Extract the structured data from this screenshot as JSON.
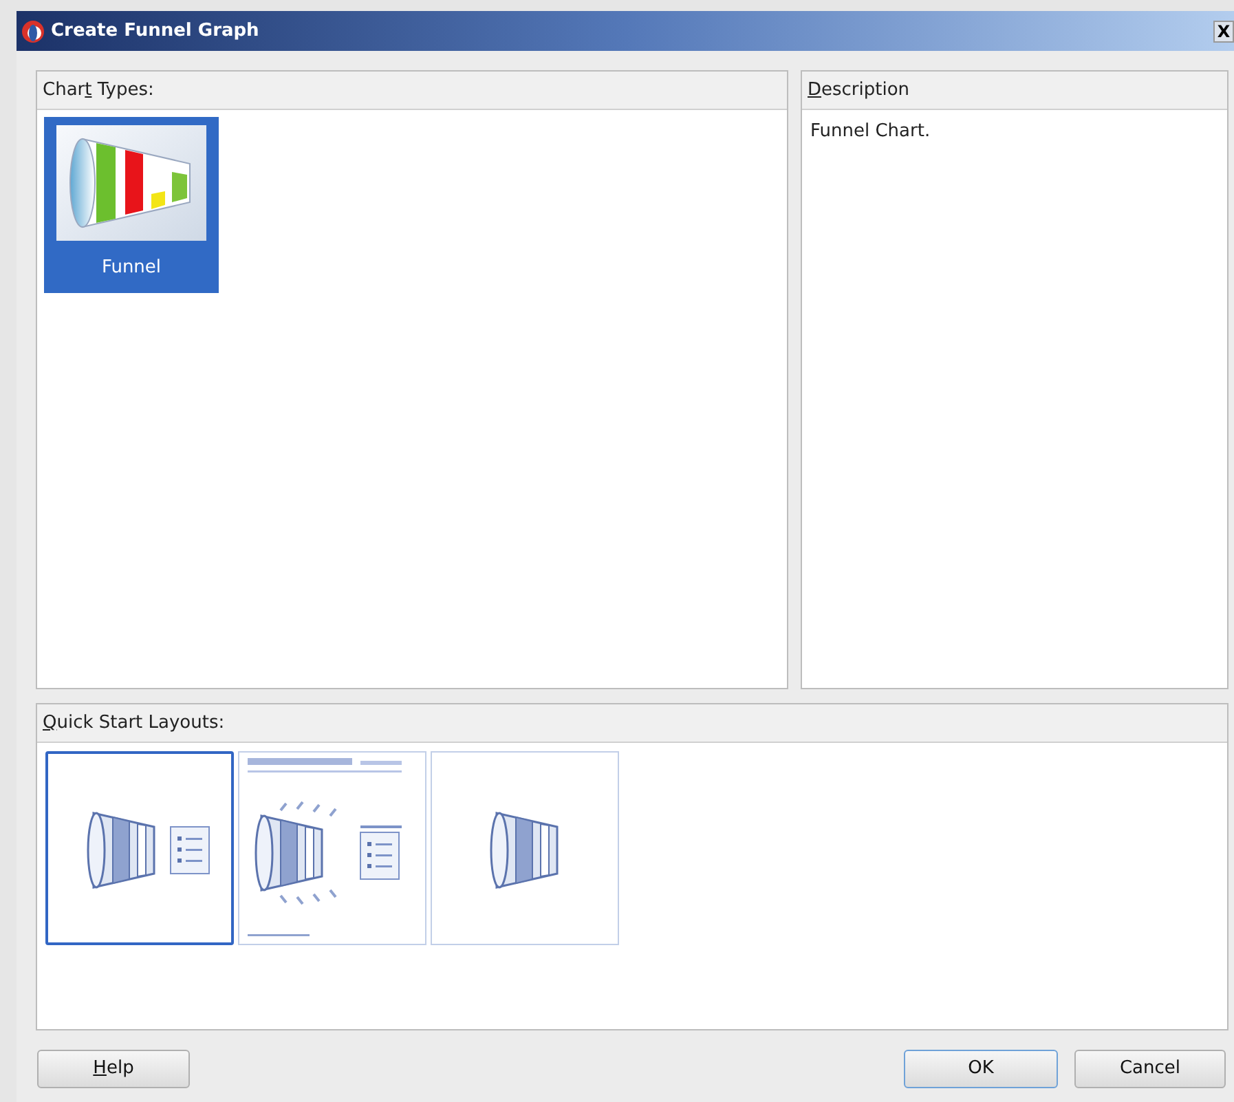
{
  "window": {
    "title": "Create Funnel Graph",
    "close_label": "X"
  },
  "chart_types": {
    "label": {
      "before": "Char",
      "mnemonic": "t",
      "after": " Types:"
    },
    "items": [
      {
        "label": "Funnel",
        "selected": true
      }
    ]
  },
  "description": {
    "label": {
      "mnemonic": "D",
      "after": "escription"
    },
    "text": "Funnel Chart."
  },
  "quick_start": {
    "label": {
      "mnemonic": "Q",
      "after": "uick Start Layouts:"
    },
    "layouts": [
      {
        "kind": "legend",
        "selected": true
      },
      {
        "kind": "titled",
        "selected": false
      },
      {
        "kind": "plain",
        "selected": false
      }
    ]
  },
  "buttons": [
    {
      "label": {
        "mnemonic": "H",
        "after": "elp"
      },
      "default": false
    },
    {
      "label": {
        "after": "OK"
      },
      "default": true
    },
    {
      "label": {
        "after": "Cancel"
      },
      "default": false
    }
  ]
}
